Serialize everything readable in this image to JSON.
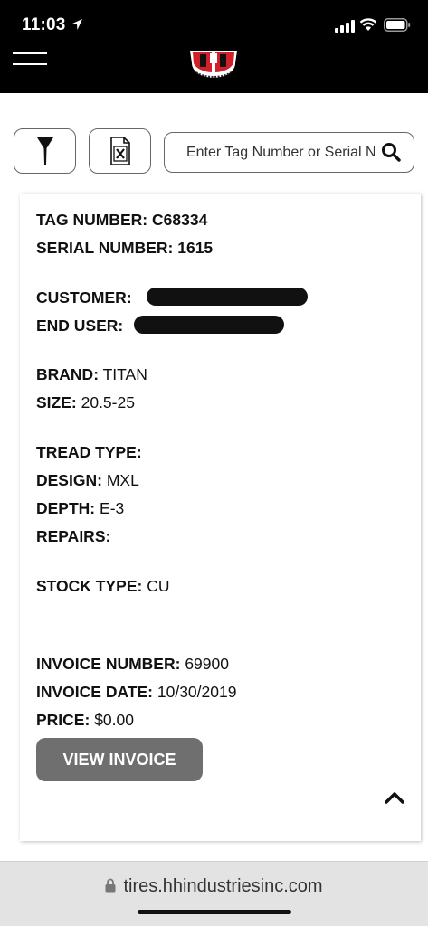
{
  "status_bar": {
    "time": "11:03",
    "icons": [
      "location-arrow-icon",
      "cellular-signal-icon",
      "wifi-icon",
      "battery-icon"
    ]
  },
  "header": {
    "menu_icon": "hamburger-menu-icon",
    "logo": "hh-industries-logo"
  },
  "toolbar": {
    "filter_icon": "filter-funnel-icon",
    "export_icon": "excel-export-icon",
    "search_placeholder": "Enter Tag Number or Serial Number",
    "search_icon": "search-icon"
  },
  "record": {
    "tag_number_label": "TAG NUMBER:",
    "tag_number": "C68334",
    "serial_number_label": "SERIAL NUMBER:",
    "serial_number": "1615",
    "customer_label": "CUSTOMER:",
    "end_user_label": "END USER:",
    "brand_label": "BRAND:",
    "brand": "TITAN",
    "size_label": "SIZE:",
    "size": "20.5-25",
    "tread_type_label": "TREAD TYPE:",
    "design_label": "DESIGN:",
    "design": "MXL",
    "depth_label": "DEPTH:",
    "depth": "E-3",
    "repairs_label": "REPAIRS:",
    "stock_type_label": "STOCK TYPE:",
    "stock_type": "CU",
    "invoice_number_label": "INVOICE NUMBER:",
    "invoice_number": "69900",
    "invoice_date_label": "INVOICE DATE:",
    "invoice_date": "10/30/2019",
    "price_label": "PRICE:",
    "price": "$0.00",
    "view_invoice_label": "VIEW INVOICE"
  },
  "scroll_top_icon": "chevron-up-icon",
  "browser": {
    "url": "tires.hhindustriesinc.com",
    "lock_icon": "lock-icon"
  },
  "colors": {
    "header_bg": "#000000",
    "button_gray": "#6f6f6f",
    "logo_red": "#d0202a"
  }
}
